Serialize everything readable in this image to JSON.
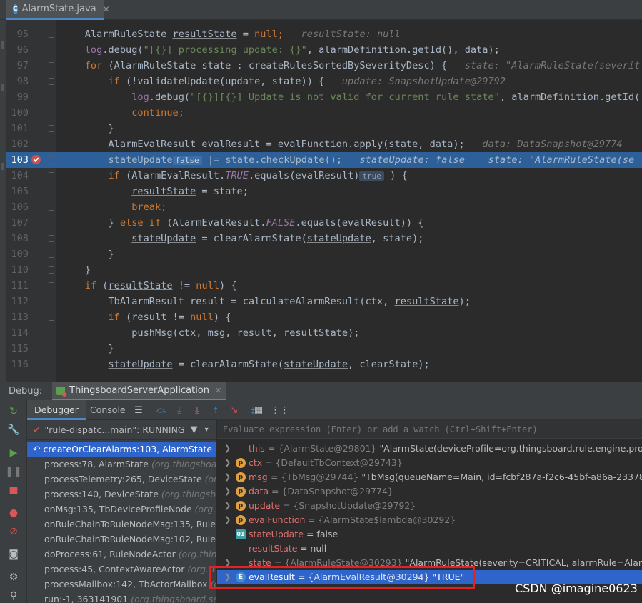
{
  "tab": {
    "filename": "AlarmState.java",
    "icon": "java-class-icon"
  },
  "code": [
    {
      "ln": "95",
      "parts": [
        [
          "    ",
          ""
        ],
        [
          "AlarmRuleState ",
          ""
        ],
        [
          "resultState",
          "u"
        ],
        [
          " = ",
          ""
        ],
        [
          "null",
          "kw"
        ],
        [
          ";",
          "kw"
        ],
        [
          "   resultState: null",
          "hint"
        ]
      ]
    },
    {
      "ln": "96",
      "parts": [
        [
          "    ",
          ""
        ],
        [
          "log",
          "fld"
        ],
        [
          ".debug(",
          ""
        ],
        [
          "\"[{}] processing update: {}\"",
          "str"
        ],
        [
          ", alarmDefinition.getId(), data);",
          ""
        ]
      ]
    },
    {
      "ln": "97",
      "parts": [
        [
          "    ",
          ""
        ],
        [
          "for",
          "kw"
        ],
        [
          " (AlarmRuleState state : createRulesSortedBySeverityDesc) {",
          ""
        ],
        [
          "   state: \"AlarmRuleState(severit",
          "hint"
        ]
      ]
    },
    {
      "ln": "98",
      "parts": [
        [
          "        ",
          ""
        ],
        [
          "if",
          "kw"
        ],
        [
          " (!validateUpdate(update, state)) {",
          ""
        ],
        [
          "   update: SnapshotUpdate@29792",
          "hint"
        ]
      ]
    },
    {
      "ln": "99",
      "parts": [
        [
          "            ",
          ""
        ],
        [
          "log",
          "fld"
        ],
        [
          ".debug(",
          ""
        ],
        [
          "\"[{}][{}] Update is not valid for current rule state\"",
          "str"
        ],
        [
          ", alarmDefinition.getId(",
          ""
        ]
      ]
    },
    {
      "ln": "100",
      "parts": [
        [
          "            ",
          ""
        ],
        [
          "continue",
          "kw"
        ],
        [
          ";",
          "kw"
        ]
      ]
    },
    {
      "ln": "101",
      "parts": [
        [
          "        }",
          ""
        ]
      ]
    },
    {
      "ln": "102",
      "parts": [
        [
          "        ",
          ""
        ],
        [
          "AlarmEvalResult evalResult = evalFunction.apply(state, data);",
          ""
        ],
        [
          "   data: DataSnapshot@29774",
          "hint"
        ]
      ]
    },
    {
      "ln": "103",
      "hl": true,
      "parts": [
        [
          "        ",
          ""
        ],
        [
          "stateUpdate",
          "u"
        ],
        [
          "false",
          "inlay"
        ],
        [
          " |= state.checkUpdate();",
          ""
        ],
        [
          "   stateUpdate: false    state: \"AlarmRuleState(se",
          "hint"
        ]
      ]
    },
    {
      "ln": "104",
      "parts": [
        [
          "        ",
          ""
        ],
        [
          "if",
          "kw"
        ],
        [
          " (AlarmEvalResult.",
          ""
        ],
        [
          "TRUE",
          "fld ital"
        ],
        [
          ".equals(evalResult)",
          ""
        ],
        [
          "true",
          "inlay"
        ],
        [
          " ) {",
          ""
        ]
      ]
    },
    {
      "ln": "105",
      "parts": [
        [
          "            ",
          ""
        ],
        [
          "resultState",
          "u"
        ],
        [
          " = state;",
          ""
        ]
      ]
    },
    {
      "ln": "106",
      "parts": [
        [
          "            ",
          ""
        ],
        [
          "break",
          "kw"
        ],
        [
          ";",
          "kw"
        ]
      ]
    },
    {
      "ln": "107",
      "parts": [
        [
          "        } ",
          ""
        ],
        [
          "else if",
          "kw"
        ],
        [
          " (AlarmEvalResult.",
          ""
        ],
        [
          "FALSE",
          "fld ital"
        ],
        [
          ".equals(evalResult)) {",
          ""
        ]
      ]
    },
    {
      "ln": "108",
      "parts": [
        [
          "            ",
          ""
        ],
        [
          "stateUpdate",
          "u"
        ],
        [
          " = clearAlarmState(",
          ""
        ],
        [
          "stateUpdate",
          "u"
        ],
        [
          ", state);",
          ""
        ]
      ]
    },
    {
      "ln": "109",
      "parts": [
        [
          "        }",
          ""
        ]
      ]
    },
    {
      "ln": "110",
      "parts": [
        [
          "    }",
          ""
        ]
      ]
    },
    {
      "ln": "111",
      "parts": [
        [
          "    ",
          ""
        ],
        [
          "if",
          "kw"
        ],
        [
          " (",
          ""
        ],
        [
          "resultState",
          "u"
        ],
        [
          " != ",
          ""
        ],
        [
          "null",
          "kw"
        ],
        [
          ") {",
          ""
        ]
      ]
    },
    {
      "ln": "112",
      "parts": [
        [
          "        ",
          ""
        ],
        [
          "TbAlarmResult result = calculateAlarmResult(ctx, ",
          ""
        ],
        [
          "resultState",
          "u"
        ],
        [
          ");",
          ""
        ]
      ]
    },
    {
      "ln": "113",
      "parts": [
        [
          "        ",
          ""
        ],
        [
          "if",
          "kw"
        ],
        [
          " (result != ",
          ""
        ],
        [
          "null",
          "kw"
        ],
        [
          ") {",
          ""
        ]
      ]
    },
    {
      "ln": "114",
      "parts": [
        [
          "            ",
          ""
        ],
        [
          "pushMsg(ctx, msg, result, ",
          ""
        ],
        [
          "resultState",
          "u"
        ],
        [
          ");",
          ""
        ]
      ]
    },
    {
      "ln": "115",
      "parts": [
        [
          "        }",
          ""
        ]
      ]
    },
    {
      "ln": "116",
      "parts": [
        [
          "        ",
          ""
        ],
        [
          "stateUpdate",
          "u"
        ],
        [
          " = clearAlarmState(",
          ""
        ],
        [
          "stateUpdate",
          "u"
        ],
        [
          ", clearState);",
          ""
        ]
      ]
    }
  ],
  "debug": {
    "label": "Debug:",
    "config_name": "ThingsboardServerApplication",
    "tabs": [
      "Debugger",
      "Console"
    ],
    "thread": "\"rule-dispatc...main\": RUNNING",
    "evaluate_placeholder": "Evaluate expression (Enter) or add a watch (Ctrl+Shift+Enter)"
  },
  "frames": [
    {
      "name": "createOrClearAlarms:103, AlarmState",
      "pkg": " (org.thing",
      "sel": true
    },
    {
      "name": "process:78, AlarmState",
      "pkg": " (org.thingsboard.",
      "sel": false
    },
    {
      "name": "processTelemetry:265, DeviceState",
      "pkg": " (org.thi",
      "sel": false
    },
    {
      "name": "process:140, DeviceState",
      "pkg": " (org.thingsboar",
      "sel": false
    },
    {
      "name": "onMsg:135, TbDeviceProfileNode",
      "pkg": " (org.thi",
      "sel": false
    },
    {
      "name": "onRuleChainToRuleNodeMsg:135, RuleNo",
      "pkg": "",
      "sel": false
    },
    {
      "name": "onRuleChainToRuleNodeMsg:102, RuleNo",
      "pkg": "",
      "sel": false
    },
    {
      "name": "doProcess:61, RuleNodeActor",
      "pkg": " (org.things",
      "sel": false
    },
    {
      "name": "process:45, ContextAwareActor",
      "pkg": " (org.thing",
      "sel": false
    },
    {
      "name": "processMailbox:142, TbActorMailbox",
      "pkg": " (org",
      "sel": false
    },
    {
      "name": "run:-1, 363141901",
      "pkg": " (org.thingsboard.serve",
      "sel": false
    }
  ],
  "variables": [
    {
      "name": "this",
      "type": " = {AlarmState@29801} ",
      "value": "\"AlarmState(deviceProfile=org.thingsboard.rule.engine.profile.Profile",
      "icon": "none",
      "arrow": true
    },
    {
      "name": "ctx",
      "type": " = {DefaultTbContext@29743}",
      "value": "",
      "icon": "p",
      "arrow": true
    },
    {
      "name": "msg",
      "type": " = {TbMsg@29744} ",
      "value": "\"TbMsg(queueName=Main, id=fcbf287a-f2c6-45bf-a86a-233782e3bf9",
      "icon": "p",
      "arrow": true
    },
    {
      "name": "data",
      "type": " = {DataSnapshot@29774}",
      "value": "",
      "icon": "p",
      "arrow": true
    },
    {
      "name": "update",
      "type": " = {SnapshotUpdate@29792}",
      "value": "",
      "icon": "p",
      "arrow": true
    },
    {
      "name": "evalFunction",
      "type": " = {AlarmState$lambda@30292}",
      "value": "",
      "icon": "p",
      "arrow": true
    },
    {
      "name": "stateUpdate",
      "type": "",
      "value": " = false",
      "icon": "eq",
      "arrow": false
    },
    {
      "name": "resultState",
      "type": "",
      "value": " = null",
      "icon": "none",
      "arrow": false
    },
    {
      "name": "state",
      "type": " = {AlarmRuleState@30293} ",
      "value": "\"AlarmRuleState(severity=CRITICAL, alarmRule=AlarmRule(co",
      "icon": "none",
      "arrow": true
    },
    {
      "name": "evalResult",
      "type": " = {AlarmEvalResult@30294} ",
      "value": "\"TRUE\"",
      "icon": "e",
      "arrow": true,
      "sel": true
    }
  ],
  "watermark": "CSDN @imagine0623"
}
